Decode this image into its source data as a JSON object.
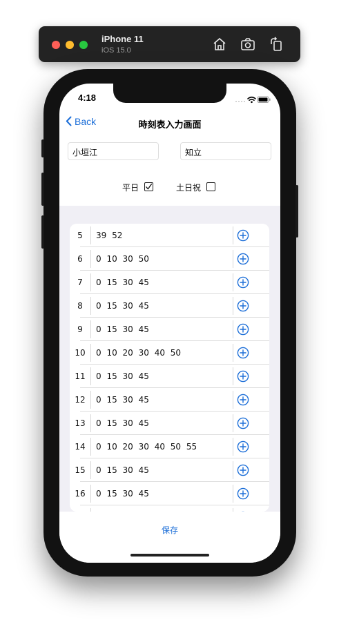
{
  "simulator": {
    "device_name": "iPhone 11",
    "os_version": "iOS 15.0",
    "icons": [
      "home-icon",
      "screenshot-icon",
      "rotate-icon"
    ]
  },
  "status_bar": {
    "time": "4:18"
  },
  "nav": {
    "back_label": "Back",
    "title": "時刻表入力画面"
  },
  "stations": {
    "from": "小垣江",
    "to": "知立"
  },
  "day_type": {
    "weekday_label": "平日",
    "weekday_checked": true,
    "holiday_label": "土日祝",
    "holiday_checked": false
  },
  "timetable": [
    {
      "hour": "5",
      "minutes": "39 52"
    },
    {
      "hour": "6",
      "minutes": "0 10 30 50"
    },
    {
      "hour": "7",
      "minutes": "0 15 30 45"
    },
    {
      "hour": "8",
      "minutes": "0 15 30 45"
    },
    {
      "hour": "9",
      "minutes": "0 15 30 45"
    },
    {
      "hour": "10",
      "minutes": "0 10 20 30 40 50"
    },
    {
      "hour": "11",
      "minutes": "0 15 30 45"
    },
    {
      "hour": "12",
      "minutes": "0 15 30 45"
    },
    {
      "hour": "13",
      "minutes": "0 15 30 45"
    },
    {
      "hour": "14",
      "minutes": "0 10 20 30 40 50 55"
    },
    {
      "hour": "15",
      "minutes": "0 15 30 45"
    },
    {
      "hour": "16",
      "minutes": "0 15 30 45"
    }
  ],
  "save_label": "保存",
  "colors": {
    "accent": "#1d6fd8",
    "list_background": "#f0eff5"
  }
}
